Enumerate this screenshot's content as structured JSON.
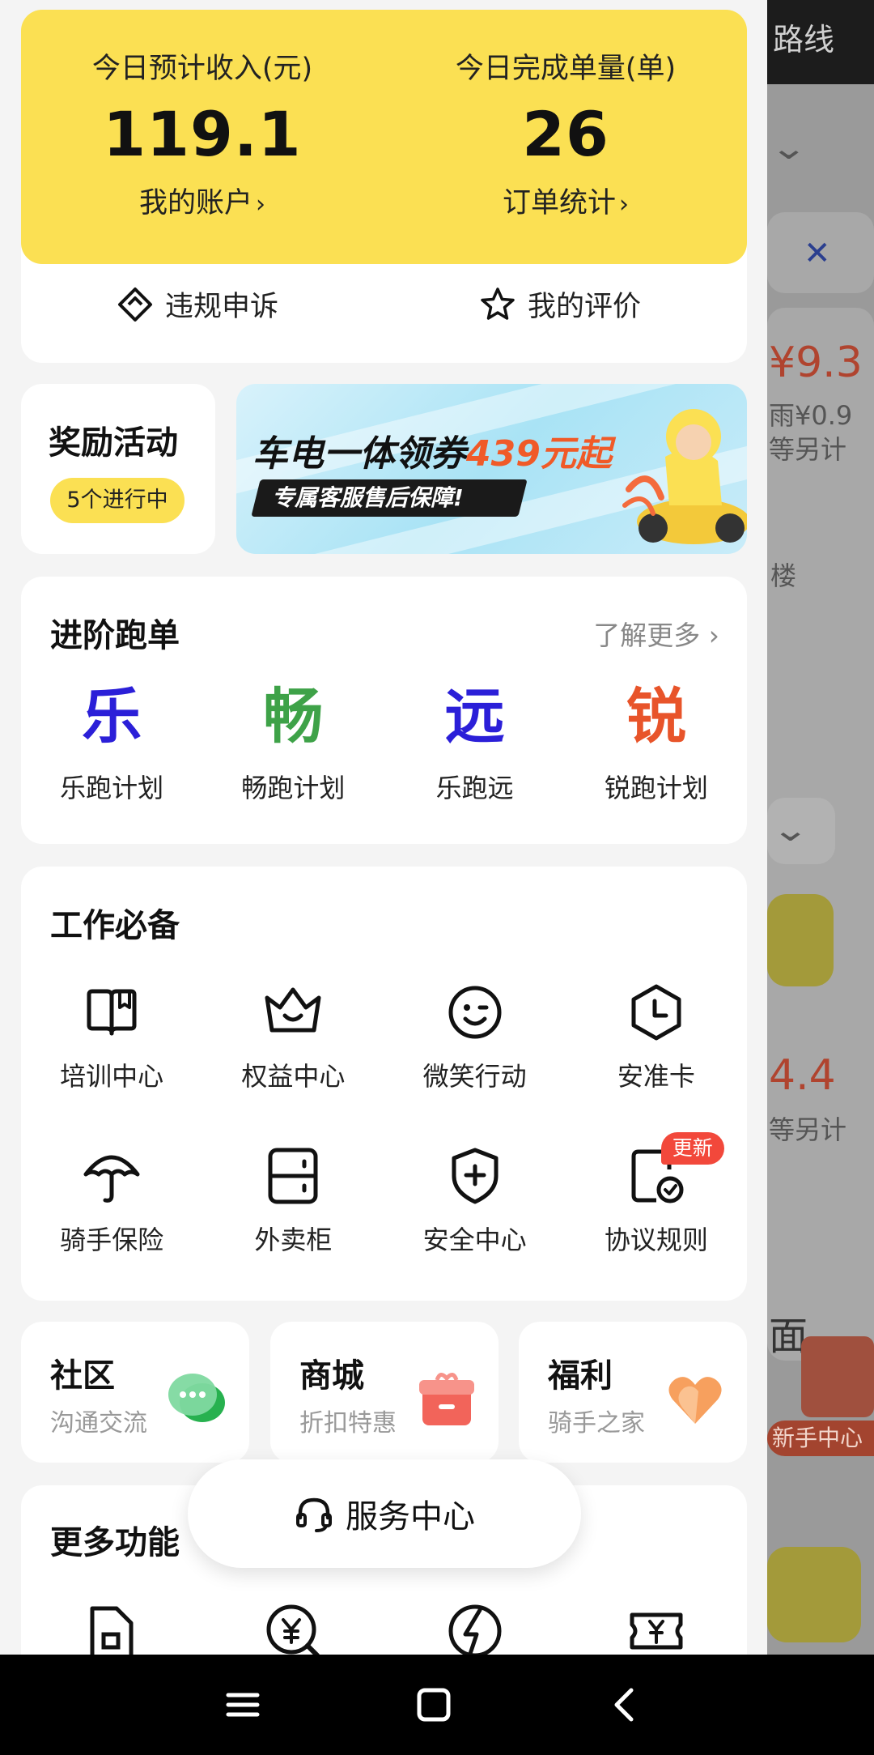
{
  "background": {
    "top_text": "路线",
    "price_1": "¥9.3",
    "line_1": "雨¥0.9",
    "line_2": "等另计",
    "line_3": "楼",
    "price_2": "4.4",
    "line_4": "等另计",
    "line_5": "面",
    "tag": "新手中心"
  },
  "earnings": {
    "income_label": "今日预计收入(元)",
    "income_value": "119.1",
    "account_link": "我的账户",
    "orders_label": "今日完成单量(单)",
    "orders_value": "26",
    "stats_link": "订单统计"
  },
  "quick": {
    "appeal_label": "违规申诉",
    "review_label": "我的评价"
  },
  "reward": {
    "title": "奖励活动",
    "badge": "5个进行中"
  },
  "banner": {
    "title_prefix": "车电一体领券",
    "title_highlight": "439元起",
    "subtitle": "专属客服售后保障!"
  },
  "advance": {
    "title": "进阶跑单",
    "more_link": "了解更多",
    "plans": [
      {
        "char": "乐",
        "label": "乐跑计划",
        "color": "#2b1fd8"
      },
      {
        "char": "畅",
        "label": "畅跑计划",
        "color": "#3ea248"
      },
      {
        "char": "远",
        "label": "乐跑远",
        "color": "#2b1fd8"
      },
      {
        "char": "锐",
        "label": "锐跑计划",
        "color": "#e8542a"
      }
    ]
  },
  "tools": {
    "title": "工作必备",
    "items": [
      {
        "label": "培训中心",
        "icon": "book-icon"
      },
      {
        "label": "权益中心",
        "icon": "crown-icon"
      },
      {
        "label": "微笑行动",
        "icon": "smile-icon"
      },
      {
        "label": "安准卡",
        "icon": "clock-icon"
      },
      {
        "label": "骑手保险",
        "icon": "umbrella-icon"
      },
      {
        "label": "外卖柜",
        "icon": "locker-icon"
      },
      {
        "label": "安全中心",
        "icon": "shield-plus-icon"
      },
      {
        "label": "协议规则",
        "icon": "agreement-icon"
      }
    ],
    "update_badge": "更新"
  },
  "shortcuts": [
    {
      "title": "社区",
      "sub": "沟通交流",
      "icon": "chat-bubble-icon"
    },
    {
      "title": "商城",
      "sub": "折扣特惠",
      "icon": "gift-box-icon"
    },
    {
      "title": "福利",
      "sub": "骑手之家",
      "icon": "heart-icon"
    }
  ],
  "more": {
    "title": "更多功能"
  },
  "service": {
    "label": "服务中心"
  }
}
